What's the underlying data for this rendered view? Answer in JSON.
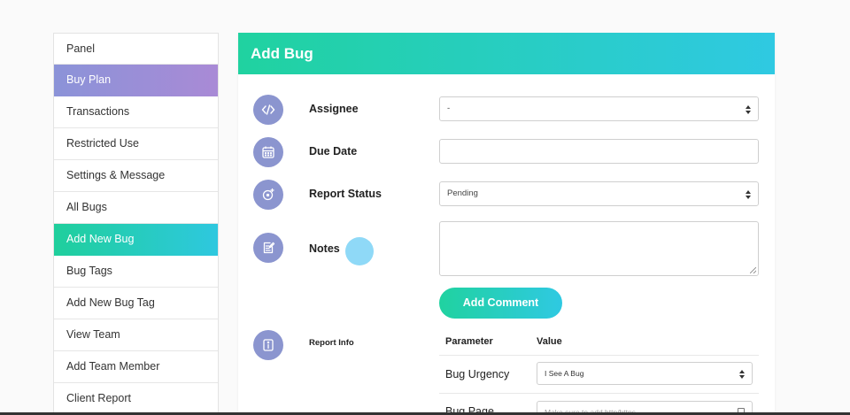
{
  "sidebar": {
    "items": [
      {
        "label": "Panel"
      },
      {
        "label": "Buy Plan"
      },
      {
        "label": "Transactions"
      },
      {
        "label": "Restricted Use"
      },
      {
        "label": "Settings & Message"
      },
      {
        "label": "All Bugs"
      },
      {
        "label": "Add New Bug"
      },
      {
        "label": "Bug Tags"
      },
      {
        "label": "Add New Bug Tag"
      },
      {
        "label": "View Team"
      },
      {
        "label": "Add Team Member"
      },
      {
        "label": "Client Report"
      }
    ]
  },
  "card": {
    "title": "Add Bug",
    "assignee": {
      "label": "Assignee",
      "value": "-"
    },
    "due_date": {
      "label": "Due Date",
      "value": ""
    },
    "report_status": {
      "label": "Report Status",
      "value": "Pending"
    },
    "notes": {
      "label": "Notes"
    },
    "add_comment_label": "Add Comment",
    "report_info": {
      "label": "Report Info",
      "columns": [
        "Parameter",
        "Value"
      ],
      "rows": [
        {
          "parameter": "Bug Urgency",
          "value": "I See A Bug"
        },
        {
          "parameter": "Bug Page",
          "placeholder": "Make sure to add http/https"
        }
      ]
    }
  },
  "colors": {
    "teal_gradient_start": "#20d2a0",
    "teal_gradient_end": "#2fc9e2",
    "purple_gradient_start": "#8b93d8",
    "purple_gradient_end": "#a98ad6",
    "icon_circle": "#8b95cf"
  },
  "icons": [
    "code-icon",
    "calendar-icon",
    "status-icon",
    "notes-icon",
    "info-icon"
  ]
}
